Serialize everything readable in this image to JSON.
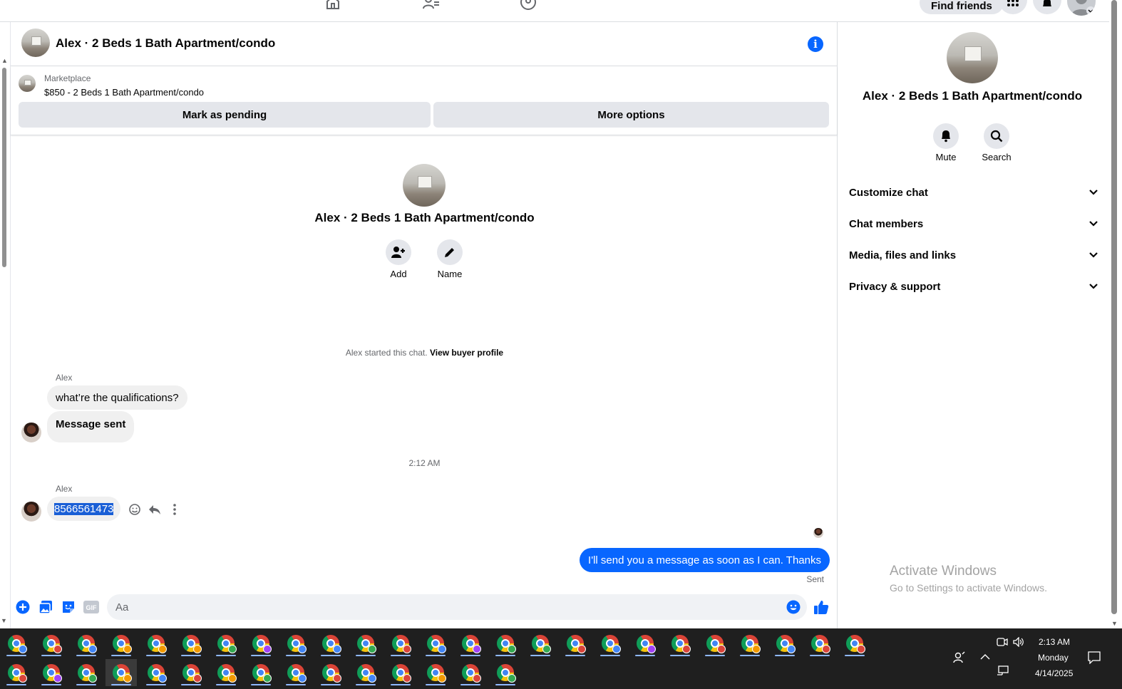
{
  "topbar": {
    "find_friends_label": "Find friends"
  },
  "chat": {
    "header_title": "Alex · 2 Beds 1 Bath Apartment/condo",
    "marketplace_label": "Marketplace",
    "listing_price_title": "$850 - 2 Beds 1 Bath Apartment/condo",
    "mark_pending_label": "Mark as pending",
    "more_options_label": "More options",
    "intro_name": "Alex · 2 Beds 1 Bath Apartment/condo",
    "add_label": "Add",
    "name_label": "Name",
    "started_text": "Alex started this chat.",
    "view_buyer_profile": "View buyer profile",
    "messages": [
      {
        "sender": "Alex",
        "text": "what’re the qualifications?"
      },
      {
        "text": "Message sent"
      },
      {
        "timestamp": "2:12 AM"
      },
      {
        "sender": "Alex",
        "text": "8566561473"
      },
      {
        "text": "I'll send you a message as soon as I can. Thanks",
        "status": "Sent"
      }
    ],
    "composer_placeholder": "Aa",
    "accent_color": "#0866ff"
  },
  "details": {
    "name": "Alex · 2 Beds 1 Bath Apartment/condo",
    "mute_label": "Mute",
    "search_label": "Search",
    "sections": [
      "Customize chat",
      "Chat members",
      "Media, files and links",
      "Privacy & support"
    ]
  },
  "watermark": {
    "line1": "Activate Windows",
    "line2": "Go to Settings to activate Windows."
  },
  "taskbar": {
    "time": "2:13 AM",
    "day": "Monday",
    "date": "4/14/2025",
    "row1_badges": [
      "#4285f4",
      "#d9443a",
      "#4285f4",
      "#f29900",
      "#f29900",
      "#f29900",
      "#34a853",
      "#a142f4",
      "#4285f4",
      "#4285f4",
      "#34a853",
      "#d9443a",
      "#4285f4",
      "#a142f4",
      "#34a853",
      "#34a853",
      "#d9443a",
      "#4285f4",
      "#a142f4",
      "#d9443a",
      "#d9443a",
      "#f29900",
      "#4285f4",
      "#d9443a",
      "#d9443a"
    ],
    "row2_badges": [
      "#d9443a",
      "#a142f4",
      "#34a853",
      "#f29900",
      "#4285f4",
      "#d9443a",
      "#f29900",
      "#34a853",
      "#4285f4",
      "#d9443a",
      "#4285f4",
      "#d9443a",
      "#f29900",
      "#d9443a",
      "#34a853"
    ]
  }
}
